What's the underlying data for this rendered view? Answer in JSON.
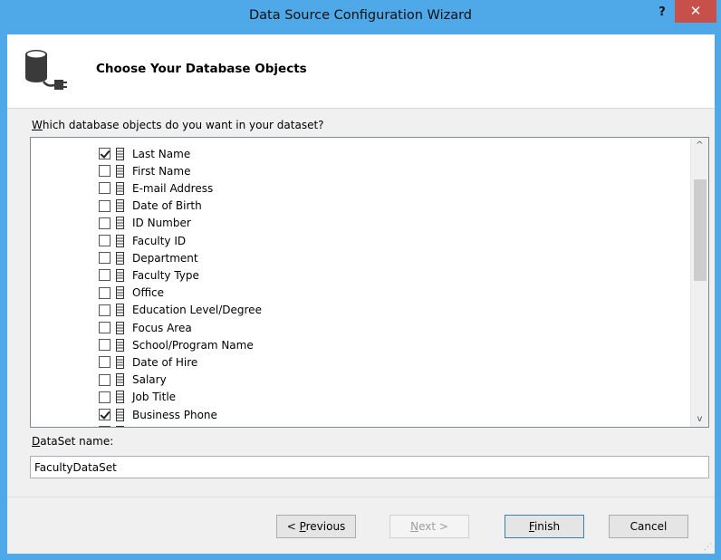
{
  "window": {
    "title": "Data Source Configuration Wizard",
    "help_label": "?",
    "close_label": "✕"
  },
  "header": {
    "title": "Choose Your Database Objects",
    "icon": "database-connect-icon"
  },
  "objects": {
    "question_mnemonic": "W",
    "question_rest": "hich database objects do you want in your dataset?",
    "items": [
      {
        "label": "Last Name",
        "checked": true
      },
      {
        "label": "First Name",
        "checked": false
      },
      {
        "label": "E-mail Address",
        "checked": false
      },
      {
        "label": "Date of Birth",
        "checked": false
      },
      {
        "label": "ID Number",
        "checked": false
      },
      {
        "label": "Faculty ID",
        "checked": false
      },
      {
        "label": "Department",
        "checked": false
      },
      {
        "label": "Faculty Type",
        "checked": false
      },
      {
        "label": "Office",
        "checked": false
      },
      {
        "label": "Education Level/Degree",
        "checked": false
      },
      {
        "label": "Focus Area",
        "checked": false
      },
      {
        "label": "School/Program Name",
        "checked": false
      },
      {
        "label": "Date of Hire",
        "checked": false
      },
      {
        "label": "Salary",
        "checked": false
      },
      {
        "label": "Job Title",
        "checked": false
      },
      {
        "label": "Business Phone",
        "checked": true
      },
      {
        "label": "Home Phone",
        "checked": false
      }
    ],
    "scroll_up_label": "^",
    "scroll_down_label": "v"
  },
  "dataset": {
    "label_mnemonic": "D",
    "label_rest": "ataSet name:",
    "value": "FacultyDataSet"
  },
  "buttons": {
    "previous": {
      "prefix": "< ",
      "mnemonic": "P",
      "rest": "revious"
    },
    "next": {
      "mnemonic": "N",
      "rest": "ext >"
    },
    "finish": {
      "mnemonic": "F",
      "rest": "inish"
    },
    "cancel": "Cancel"
  },
  "colors": {
    "titlebar": "#4fa8e8",
    "close_button": "#c7504b"
  }
}
